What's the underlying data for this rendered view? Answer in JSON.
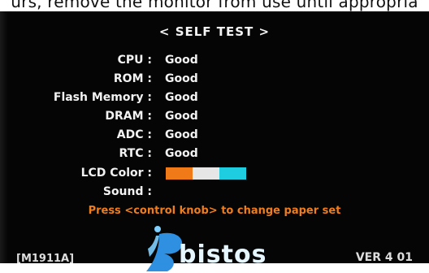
{
  "caption": "urs, remove the monitor from use until appropria",
  "title": "< SELF TEST >",
  "results": [
    {
      "label": "CPU :",
      "value": "Good"
    },
    {
      "label": "ROM :",
      "value": "Good"
    },
    {
      "label": "Flash Memory :",
      "value": "Good"
    },
    {
      "label": "DRAM :",
      "value": "Good"
    },
    {
      "label": "ADC :",
      "value": "Good"
    },
    {
      "label": "RTC :",
      "value": "Good"
    }
  ],
  "lcd_color": {
    "label": "LCD Color :",
    "colors": [
      "#f07a18",
      "#e6e6e6",
      "#1ecde0"
    ]
  },
  "sound": {
    "label": "Sound :"
  },
  "hint": "Press <control knob> to change paper set",
  "model": "[M1911A]",
  "brand": "bistos",
  "version": "VER 4 01"
}
